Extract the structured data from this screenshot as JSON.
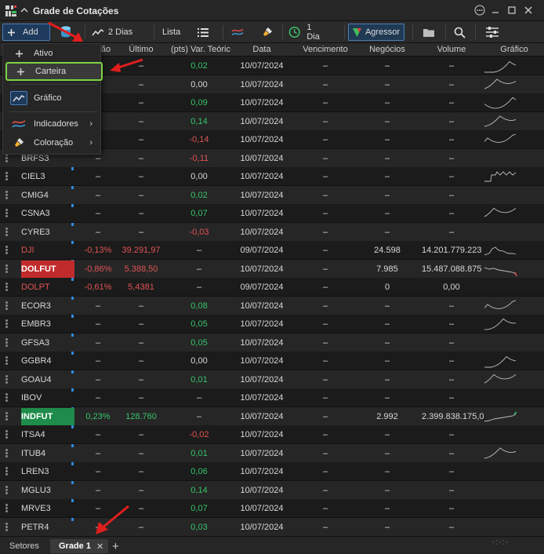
{
  "window": {
    "title": "Grade de Cotações"
  },
  "toolbar": {
    "add_label": "Add",
    "days2_label": "2 Dias",
    "lista_label": "Lista",
    "day1_label": "1 Dia",
    "agressor_label": "Agressor"
  },
  "columns": {
    "var": "ão",
    "ultimo": "Último",
    "pts": "(pts) Var. Teóric",
    "data": "Data",
    "vencimento": "Vencimento",
    "negocios": "Negócios",
    "volume": "Volume",
    "grafico": "Gráfico"
  },
  "menu": {
    "ativo": "Ativo",
    "carteira": "Carteira",
    "grafico": "Gráfico",
    "indicadores": "Indicadores",
    "coloracao": "Coloração"
  },
  "rows": [
    {
      "sym": "",
      "var": "",
      "last": "–",
      "pts": "0,02",
      "date": "10/07/2024",
      "venc": "–",
      "neg": "–",
      "vol": "–"
    },
    {
      "sym": "",
      "var": "",
      "last": "–",
      "pts": "0,00",
      "date": "10/07/2024",
      "venc": "–",
      "neg": "–",
      "vol": "–"
    },
    {
      "sym": "",
      "var": "",
      "last": "–",
      "pts": "0,09",
      "date": "10/07/2024",
      "venc": "–",
      "neg": "–",
      "vol": "–"
    },
    {
      "sym": "",
      "var": "",
      "last": "–",
      "pts": "0,14",
      "date": "10/07/2024",
      "venc": "–",
      "neg": "–",
      "vol": "–"
    },
    {
      "sym": "",
      "var": "",
      "last": "–",
      "pts": "-0,14",
      "date": "10/07/2024",
      "venc": "–",
      "neg": "–",
      "vol": "–"
    },
    {
      "sym": "BRFS3",
      "var": "–",
      "last": "–",
      "pts": "-0,11",
      "date": "10/07/2024",
      "venc": "–",
      "neg": "–",
      "vol": "–"
    },
    {
      "sym": "CIEL3",
      "var": "–",
      "last": "–",
      "pts": "0,00",
      "date": "10/07/2024",
      "venc": "–",
      "neg": "–",
      "vol": "–"
    },
    {
      "sym": "CMIG4",
      "var": "–",
      "last": "–",
      "pts": "0,02",
      "date": "10/07/2024",
      "venc": "–",
      "neg": "–",
      "vol": "–"
    },
    {
      "sym": "CSNA3",
      "var": "–",
      "last": "–",
      "pts": "0,07",
      "date": "10/07/2024",
      "venc": "–",
      "neg": "–",
      "vol": "–"
    },
    {
      "sym": "CYRE3",
      "var": "–",
      "last": "–",
      "pts": "-0,03",
      "date": "10/07/2024",
      "venc": "–",
      "neg": "–",
      "vol": "–"
    },
    {
      "sym": "DJI",
      "var": "-0,13%",
      "last": "39.291,97",
      "pts": "–",
      "date": "09/07/2024",
      "venc": "–",
      "neg": "24.598",
      "vol": "14.201.779.223"
    },
    {
      "sym": "DOLFUT",
      "var": "-0,86%",
      "last": "5.388,50",
      "pts": "–",
      "date": "10/07/2024",
      "venc": "–",
      "neg": "7.985",
      "vol": "15.487.088.875"
    },
    {
      "sym": "DOLPT",
      "var": "-0,61%",
      "last": "5,4381",
      "pts": "–",
      "date": "09/07/2024",
      "venc": "–",
      "neg": "0",
      "vol": "0,00"
    },
    {
      "sym": "ECOR3",
      "var": "–",
      "last": "–",
      "pts": "0,08",
      "date": "10/07/2024",
      "venc": "–",
      "neg": "–",
      "vol": "–"
    },
    {
      "sym": "EMBR3",
      "var": "–",
      "last": "–",
      "pts": "0,05",
      "date": "10/07/2024",
      "venc": "–",
      "neg": "–",
      "vol": "–"
    },
    {
      "sym": "GFSA3",
      "var": "–",
      "last": "–",
      "pts": "0,05",
      "date": "10/07/2024",
      "venc": "–",
      "neg": "–",
      "vol": "–"
    },
    {
      "sym": "GGBR4",
      "var": "–",
      "last": "–",
      "pts": "0,00",
      "date": "10/07/2024",
      "venc": "–",
      "neg": "–",
      "vol": "–"
    },
    {
      "sym": "GOAU4",
      "var": "–",
      "last": "–",
      "pts": "0,01",
      "date": "10/07/2024",
      "venc": "–",
      "neg": "–",
      "vol": "–"
    },
    {
      "sym": "IBOV",
      "var": "–",
      "last": "–",
      "pts": "–",
      "date": "10/07/2024",
      "venc": "–",
      "neg": "–",
      "vol": "–"
    },
    {
      "sym": "INDFUT",
      "var": "0,23%",
      "last": "128.760",
      "pts": "–",
      "date": "10/07/2024",
      "venc": "–",
      "neg": "2.992",
      "vol": "2.399.838.175,0"
    },
    {
      "sym": "ITSA4",
      "var": "–",
      "last": "–",
      "pts": "-0,02",
      "date": "10/07/2024",
      "venc": "–",
      "neg": "–",
      "vol": "–"
    },
    {
      "sym": "ITUB4",
      "var": "–",
      "last": "–",
      "pts": "0,01",
      "date": "10/07/2024",
      "venc": "–",
      "neg": "–",
      "vol": "–"
    },
    {
      "sym": "LREN3",
      "var": "–",
      "last": "–",
      "pts": "0,06",
      "date": "10/07/2024",
      "venc": "–",
      "neg": "–",
      "vol": "–"
    },
    {
      "sym": "MGLU3",
      "var": "–",
      "last": "–",
      "pts": "0,14",
      "date": "10/07/2024",
      "venc": "–",
      "neg": "–",
      "vol": "–"
    },
    {
      "sym": "MRVE3",
      "var": "–",
      "last": "–",
      "pts": "0,07",
      "date": "10/07/2024",
      "venc": "–",
      "neg": "–",
      "vol": "–"
    },
    {
      "sym": "PETR4",
      "var": "–",
      "last": "–",
      "pts": "0,03",
      "date": "10/07/2024",
      "venc": "–",
      "neg": "–",
      "vol": "–"
    }
  ],
  "tabs": {
    "setores": "Setores",
    "grade1": "Grade 1"
  },
  "colors": {
    "accent": "#4a7db8",
    "positive": "#35c46a",
    "negative": "#e05353",
    "highlight": "#7cd343"
  }
}
